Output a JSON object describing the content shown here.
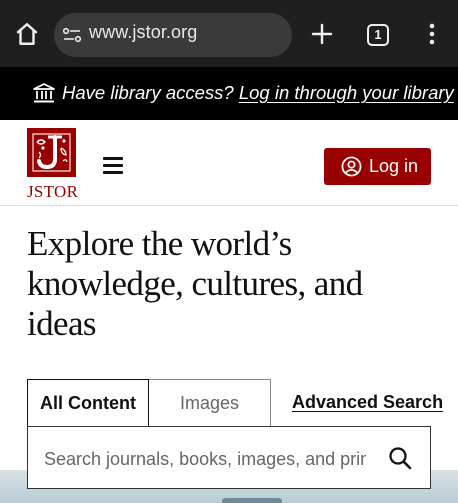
{
  "browser": {
    "url": "www.jstor.org",
    "tab_count": "1",
    "icons": [
      "home-icon",
      "site-settings-icon",
      "new-tab-icon",
      "tab-switcher-icon",
      "more-menu-icon"
    ]
  },
  "library_bar": {
    "prompt": "Have library access?",
    "link": "Log in through your library",
    "icon": "institution-icon"
  },
  "header": {
    "logo_text": "JSTOR",
    "login_label": "Log in",
    "brand_color": "#990000"
  },
  "headline": "Explore the world’s knowledge, cultures, and ideas",
  "search": {
    "tabs": [
      {
        "label": "All Content",
        "active": true
      },
      {
        "label": "Images",
        "active": false
      }
    ],
    "advanced_label": "Advanced Search",
    "placeholder": "Search journals, books, images, and primary sources"
  }
}
